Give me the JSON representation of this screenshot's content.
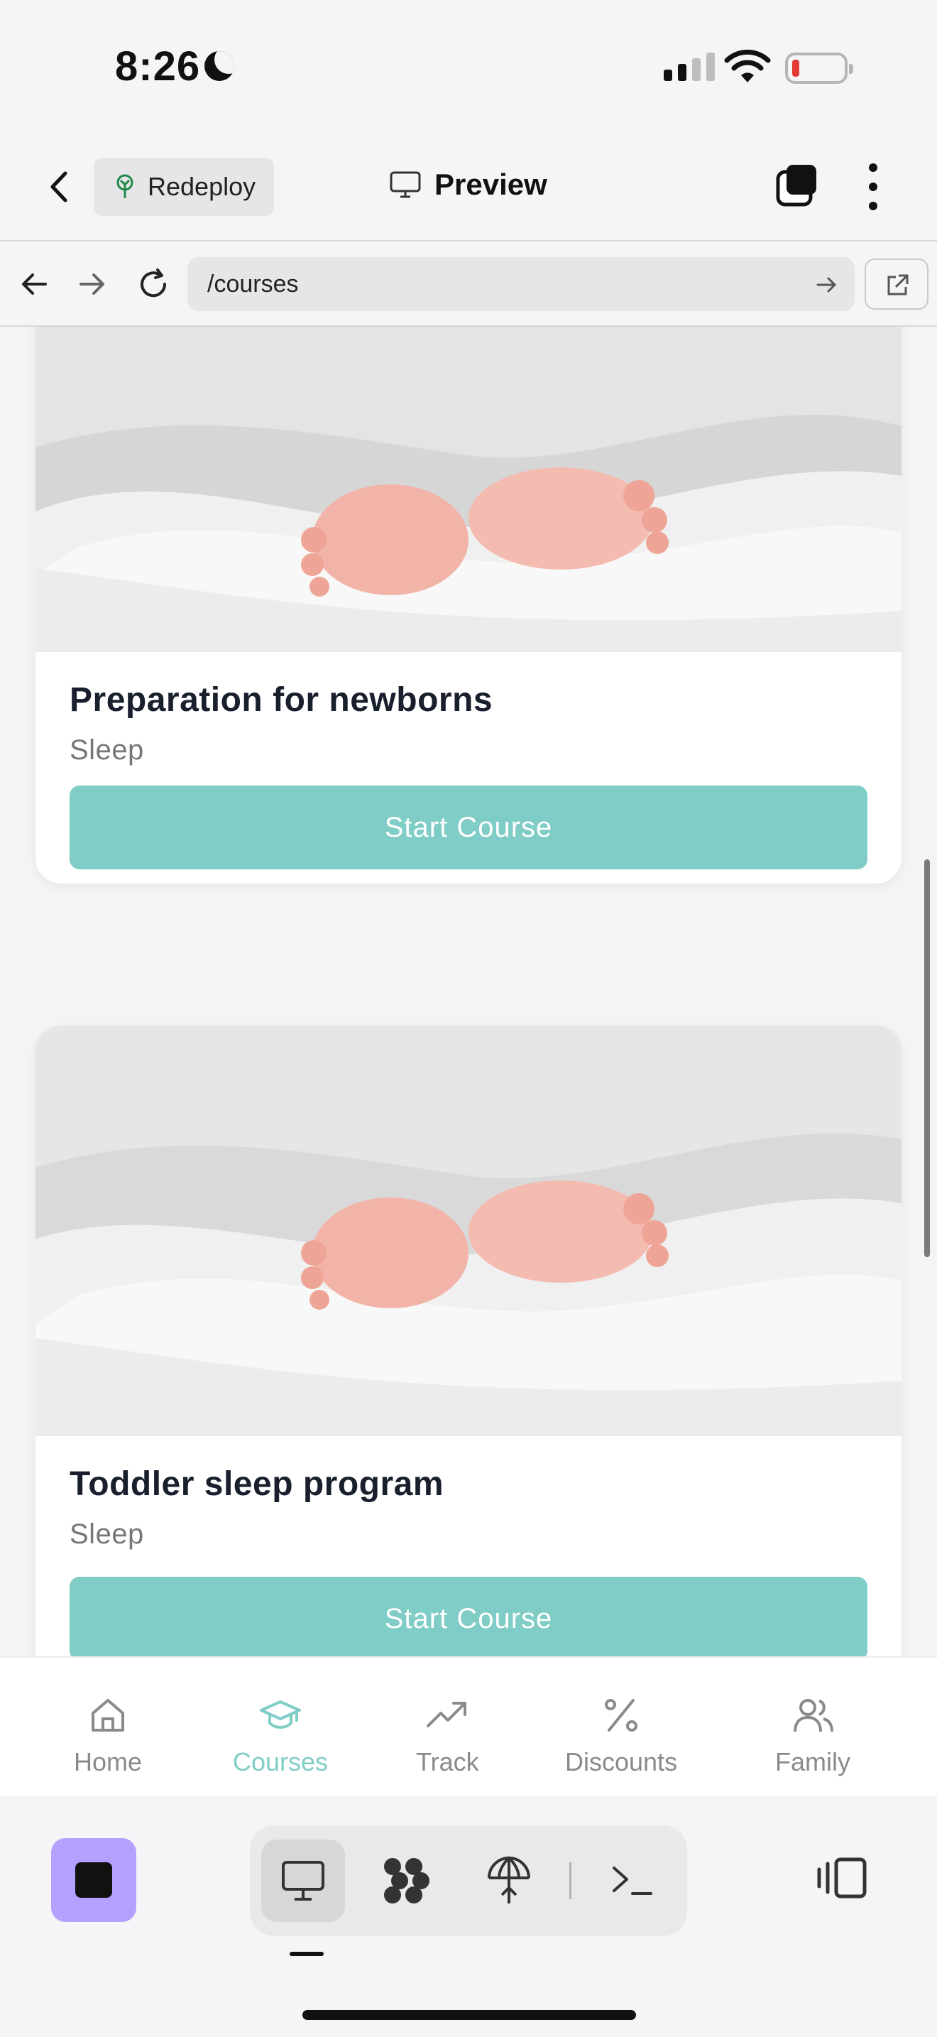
{
  "status_bar": {
    "time": "8:26"
  },
  "app_bar": {
    "redeploy_label": "Redeploy",
    "preview_label": "Preview"
  },
  "url_bar": {
    "path": "/courses"
  },
  "courses": [
    {
      "title": "Preparation for newborns",
      "category": "Sleep",
      "button_label": "Start Course"
    },
    {
      "title": "Toddler sleep program",
      "category": "Sleep",
      "button_label": "Start Course"
    }
  ],
  "tab_nav": {
    "items": [
      {
        "label": "Home",
        "icon": "home-icon",
        "active": false
      },
      {
        "label": "Courses",
        "icon": "graduation-cap-icon",
        "active": true
      },
      {
        "label": "Track",
        "icon": "trending-up-icon",
        "active": false
      },
      {
        "label": "Discounts",
        "icon": "percent-icon",
        "active": false
      },
      {
        "label": "Family",
        "icon": "users-icon",
        "active": false
      }
    ],
    "accent_color": "#7fcdc6"
  },
  "dev_toolbar": {
    "app_color": "#b4a0ff",
    "tools": [
      "desktop-preview-icon",
      "workflows-icon",
      "deploy-icon",
      "terminal-icon"
    ]
  }
}
